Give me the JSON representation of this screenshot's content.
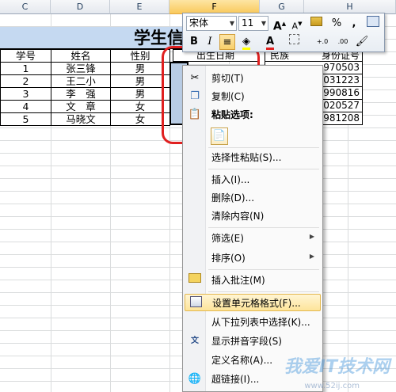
{
  "columns": [
    "C",
    "D",
    "E",
    "F",
    "G",
    "H"
  ],
  "sheet": {
    "title": "学生信",
    "headers": [
      "学号",
      "姓名",
      "性别"
    ],
    "rows": [
      [
        "1",
        "张三锋",
        "男"
      ],
      [
        "2",
        "王二小",
        "男"
      ],
      [
        "3",
        "李　强",
        "男"
      ],
      [
        "4",
        "文　章",
        "女"
      ],
      [
        "5",
        "马晓文",
        "女"
      ]
    ],
    "f_header": "出生日期",
    "g_header": "民族",
    "h_header": "身份证号",
    "h_values": [
      "970503",
      "031223",
      "990816",
      "020527",
      "981208"
    ]
  },
  "mini_toolbar": {
    "font_name": "宋体",
    "font_size": "11",
    "grow_font": "A",
    "shrink_font": "A",
    "percent": "%",
    "comma": ",",
    "bold": "B",
    "italic": "I",
    "increase_decimal": "+.0",
    "decrease_decimal": ".00"
  },
  "menu": {
    "items": [
      {
        "label": "剪切(T)",
        "icon": "scissors-icon"
      },
      {
        "label": "复制(C)",
        "icon": "copy-icon"
      },
      {
        "label": "粘贴选项:",
        "icon": "clipboard-icon"
      },
      {
        "label": "选择性粘贴(S)...",
        "icon": ""
      },
      {
        "label": "插入(I)...",
        "icon": ""
      },
      {
        "label": "删除(D)...",
        "icon": ""
      },
      {
        "label": "清除内容(N)",
        "icon": ""
      },
      {
        "label": "筛选(E)",
        "icon": ""
      },
      {
        "label": "排序(O)",
        "icon": ""
      },
      {
        "label": "插入批注(M)",
        "icon": "comment-icon"
      },
      {
        "label": "设置单元格格式(F)...",
        "icon": "format-cells-icon"
      },
      {
        "label": "从下拉列表中选择(K)...",
        "icon": ""
      },
      {
        "label": "显示拼音字段(S)",
        "icon": "phonetic-icon"
      },
      {
        "label": "定义名称(A)...",
        "icon": ""
      },
      {
        "label": "超链接(I)...",
        "icon": "hyperlink-icon"
      }
    ]
  },
  "watermark": "我爱IT技术网",
  "watermark_url": "www.52ij.com"
}
